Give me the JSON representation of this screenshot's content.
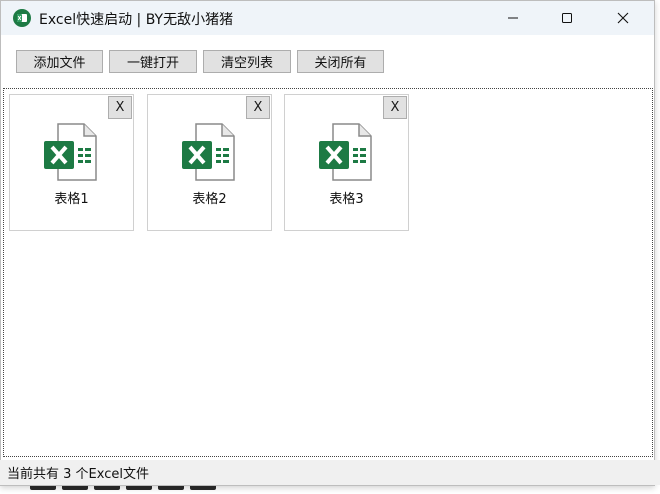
{
  "window": {
    "title": "Excel快速启动 | BY无敌小猪猪"
  },
  "toolbar": {
    "add_file": "添加文件",
    "open_all": "一键打开",
    "clear_list": "清空列表",
    "close_all": "关闭所有"
  },
  "files": [
    {
      "label": "表格1",
      "close": "X"
    },
    {
      "label": "表格2",
      "close": "X"
    },
    {
      "label": "表格3",
      "close": "X"
    }
  ],
  "status": {
    "text": "当前共有 3 个Excel文件"
  },
  "colors": {
    "excel_green": "#1d7a44",
    "titlebar_bg": "#eff4f9",
    "button_bg": "#e1e1e1"
  },
  "icons": {
    "app": "excel-app-icon",
    "file": "excel-file-icon"
  }
}
